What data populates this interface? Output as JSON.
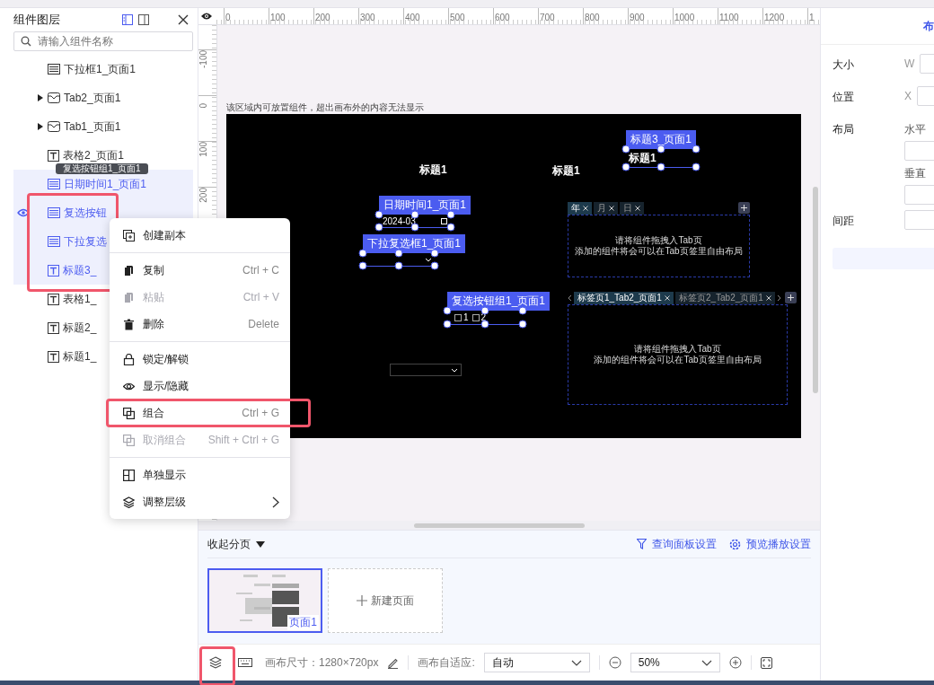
{
  "layer_panel": {
    "title": "组件图层",
    "view_toggles": [
      {
        "selected": true
      },
      {
        "selected": false
      }
    ],
    "search": {
      "placeholder": "请输入组件名称"
    },
    "selection_highlighted": true,
    "tooltip": "复选按钮组1_页面1",
    "layers": [
      {
        "name": "下拉框1_页面1",
        "kind": "select",
        "selected": false,
        "hovered": false
      },
      {
        "name": "Tab2_页面1",
        "kind": "tab",
        "selected": false,
        "hovered": false,
        "expanded": false
      },
      {
        "name": "Tab1_页面1",
        "kind": "tab",
        "selected": false,
        "hovered": false,
        "expanded": false
      },
      {
        "name": "表格2_页面1",
        "kind": "text",
        "selected": false,
        "hovered": false
      },
      {
        "name": "日期时间1_页面1",
        "kind": "select",
        "selected": true,
        "hovered": false
      },
      {
        "name": "复选按钮",
        "kind": "select",
        "selected": true,
        "hovered": true
      },
      {
        "name": "下拉复选",
        "kind": "select",
        "selected": true,
        "hovered": false
      },
      {
        "name": "标题3_",
        "kind": "text",
        "selected": true,
        "hovered": false
      },
      {
        "name": "表格1_",
        "kind": "text",
        "selected": false,
        "hovered": false
      },
      {
        "name": "标题2_",
        "kind": "text",
        "selected": false,
        "hovered": false
      },
      {
        "name": "标题1_",
        "kind": "text",
        "selected": false,
        "hovered": false
      }
    ]
  },
  "context_menu": {
    "sections": [
      [
        {
          "label": "创建副本",
          "disabled": false,
          "highlighted": false,
          "submenu": false
        }
      ],
      [
        {
          "label": "复制",
          "shortcut": "Ctrl + C",
          "disabled": false,
          "highlighted": false,
          "submenu": false
        },
        {
          "label": "粘贴",
          "shortcut": "Ctrl + V",
          "disabled": true,
          "highlighted": false,
          "submenu": false
        },
        {
          "label": "删除",
          "shortcut": "Delete",
          "disabled": false,
          "highlighted": false,
          "submenu": false
        }
      ],
      [
        {
          "label": "锁定/解锁",
          "disabled": false,
          "highlighted": false,
          "submenu": false
        },
        {
          "label": "显示/隐藏",
          "disabled": false,
          "highlighted": false,
          "submenu": false
        },
        {
          "label": "组合",
          "shortcut": "Ctrl + G",
          "disabled": false,
          "highlighted": true,
          "submenu": false
        },
        {
          "label": "取消组合",
          "shortcut": "Shift + Ctrl + G",
          "disabled": true,
          "highlighted": false,
          "submenu": false
        }
      ],
      [
        {
          "label": "单独显示",
          "disabled": false,
          "highlighted": false,
          "submenu": false
        },
        {
          "label": "调整层级",
          "disabled": false,
          "highlighted": false,
          "submenu": true
        }
      ]
    ]
  },
  "top_ruler": [
    "0",
    "100",
    "200",
    "300",
    "400",
    "500",
    "600",
    "700",
    "800",
    "900",
    "1000",
    "1100",
    "1200",
    "1"
  ],
  "left_ruler": [
    "-100",
    "0",
    "100",
    "200"
  ],
  "canvas": {
    "hint": "该区域内可放置组件，超出画布外的内容无法显示",
    "widgets": [
      {
        "kind": "title",
        "text": "标题1",
        "selected": false
      },
      {
        "kind": "title",
        "text": "标题1",
        "selected": false
      },
      {
        "kind": "title",
        "text": "标题1",
        "selected": true,
        "label": "标题3_页面1"
      },
      {
        "kind": "datetime",
        "value": "2024-03",
        "selected": true,
        "label": "日期时间1_页面1"
      },
      {
        "kind": "multiselect",
        "selected": true,
        "label": "下拉复选框1_页面1"
      },
      {
        "kind": "checkboxes",
        "options": [
          {
            "label": "1",
            "checked": false
          },
          {
            "label": "2",
            "checked": false
          }
        ],
        "selected": true,
        "label": "复选按钮组1_页面1"
      },
      {
        "kind": "select",
        "selected": false
      },
      {
        "kind": "tabs",
        "arrows": false,
        "tabs": [
          {
            "label": "年",
            "selected": true
          },
          {
            "label": "月",
            "selected": false
          },
          {
            "label": "日",
            "selected": false
          }
        ],
        "lines": [
          "请将组件拖拽入Tab页",
          "添加的组件将会可以在Tab页签里自由布局"
        ]
      },
      {
        "kind": "tabs",
        "arrows": true,
        "tabs": [
          {
            "label": "标签页1_Tab2_页面1",
            "selected": true
          },
          {
            "label": "标签页2_Tab2_页面1",
            "selected": false
          }
        ],
        "lines": [
          "请将组件拖拽入Tab页",
          "添加的组件将会可以在Tab页签里自由布局"
        ]
      }
    ]
  },
  "pages_panel": {
    "collapse_label": "收起分页",
    "links": [
      {
        "label": "查询面板设置"
      },
      {
        "label": "预览播放设置"
      }
    ],
    "pages": [
      {
        "name": "页面1",
        "selected": true
      }
    ],
    "new_page": "新建页面"
  },
  "toolbar": {
    "layers_highlighted": true,
    "canvas_size": "画布尺寸：1280×720px",
    "fit_label": "画布自适应:",
    "fit_value": "自动",
    "zoom_value": "50%"
  },
  "right_panel": {
    "tabs": [
      {
        "label": "布",
        "selected": true
      }
    ],
    "rows": [
      {
        "kind": "pair",
        "label": "大小",
        "axis": "W"
      },
      {
        "kind": "pair",
        "label": "位置",
        "axis": "X"
      },
      {
        "kind": "layout",
        "label": "布局",
        "subs": [
          "水平",
          "垂直"
        ]
      },
      {
        "kind": "field",
        "label": "间距"
      }
    ]
  }
}
